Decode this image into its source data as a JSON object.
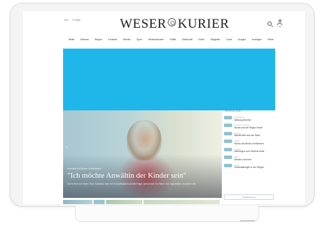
{
  "brand": {
    "name_left": "WESER",
    "name_right": "KURIER"
  },
  "header": {
    "tiny_links": [
      "Abo",
      "E-Paper"
    ],
    "account_label": "Login"
  },
  "nav": {
    "items": [
      "Bilder",
      "Bremen",
      "Region",
      "Fussball",
      "Werder",
      "Sport",
      "Niedersachsen",
      "Politik",
      "Wirtschaft",
      "Kultur",
      "Ratgeber",
      "Leute",
      "Ausgeh",
      "Anzeigen",
      "Reise"
    ]
  },
  "hero": {
    "kicker": "Interview mit Bremer Schülerinnen",
    "title": "\"Ich möchte Anwältin der Kinder sein\"",
    "teaser": "Sie ist eine von vielen: Eine Schülerin über ihre Zukunftspläne und die Frage, wie sie sich für Kinder und Jugendliche einsetzen will."
  },
  "ticker": {
    "title": "Newsticker",
    "items": [
      {
        "time": "",
        "category": "Regionales",
        "headline": "Meldung Bremen"
      },
      {
        "time": "",
        "category": "Aus dem Umland",
        "headline": "Neues aus der Region heute"
      },
      {
        "time": "",
        "category": "Bremen",
        "headline": "Nachrichten aus der Stadt"
      },
      {
        "time": "",
        "category": "Politik",
        "headline": "Neues aus Berlin und Bremen"
      },
      {
        "time": "",
        "category": "Verkehr",
        "headline": "Meldungen zum Verkehr heute"
      },
      {
        "time": "",
        "category": "Sport",
        "headline": "Werder und mehr"
      },
      {
        "time": "",
        "category": "Kultur",
        "headline": "Veranstaltungen in der Region"
      }
    ],
    "more_label": "Alle Meldungen"
  },
  "colors": {
    "ad_banner": "#1fb7ea",
    "ticker_accent": "#8fc3cf"
  }
}
